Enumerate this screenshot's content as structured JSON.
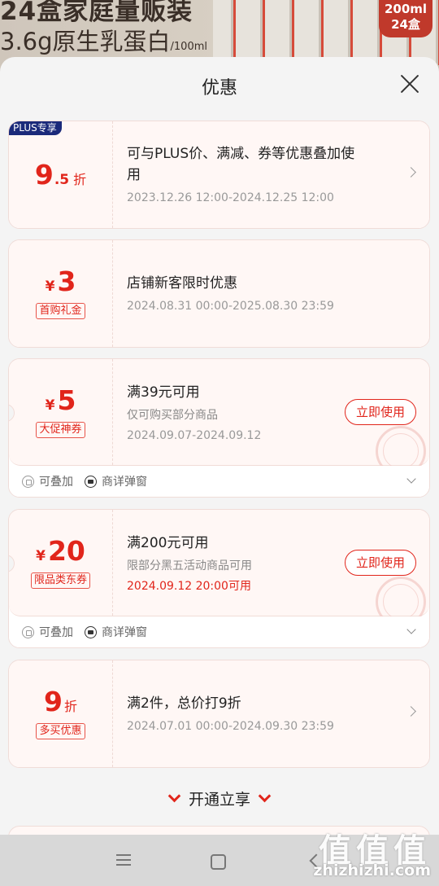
{
  "background": {
    "line1": "24盒家庭量贩装",
    "line2": "3.6g原生乳蛋白",
    "line2_unit": "/100ml",
    "badge_line1": "200ml",
    "badge_line2": "24盒"
  },
  "sheet": {
    "title": "优惠"
  },
  "coupons": [
    {
      "plus_tag": "PLUS专享",
      "amount": "9",
      "amount_dec": ".5",
      "suffix": "折",
      "title": "可与PLUS价、满减、券等优惠叠加使用",
      "date": "2023.12.26 12:00-2024.12.25 12:00"
    },
    {
      "currency": "¥",
      "amount": "3",
      "tag": "首购礼金",
      "title": "店铺新客限时优惠",
      "date": "2024.08.31 00:00-2025.08.30 23:59"
    },
    {
      "currency": "¥",
      "amount": "5",
      "tag": "大促神券",
      "title": "满39元可用",
      "sub": "仅可购买部分商品",
      "date": "2024.09.07-2024.09.12",
      "button": "立即使用",
      "foot": [
        "可叠加",
        "商详弹窗"
      ]
    },
    {
      "currency": "¥",
      "amount": "20",
      "tag": "限品类东券",
      "title": "满200元可用",
      "sub": "限部分黑五活动商品可用",
      "date": "2024.09.12 20:00可用",
      "button": "立即使用",
      "foot": [
        "可叠加",
        "商详弹窗"
      ]
    },
    {
      "amount": "9",
      "suffix": "折",
      "tag": "多买优惠",
      "title": "满2件，总价打9折",
      "date": "2024.07.01 00:00-2024.09.30 23:59"
    }
  ],
  "open_label": "开通立享",
  "watermark": {
    "glyphs": "值值值",
    "url": "zhizhizhi.com"
  },
  "colors": {
    "accent": "#e1251b",
    "plus_tag_bg": "#1b2a7a",
    "card_bg": "#fff7f5"
  },
  "icons": [
    "close-icon",
    "chevron-right-icon",
    "stack-icon",
    "popup-icon",
    "chevron-down-icon",
    "menu-icon",
    "home-icon",
    "back-icon"
  ]
}
